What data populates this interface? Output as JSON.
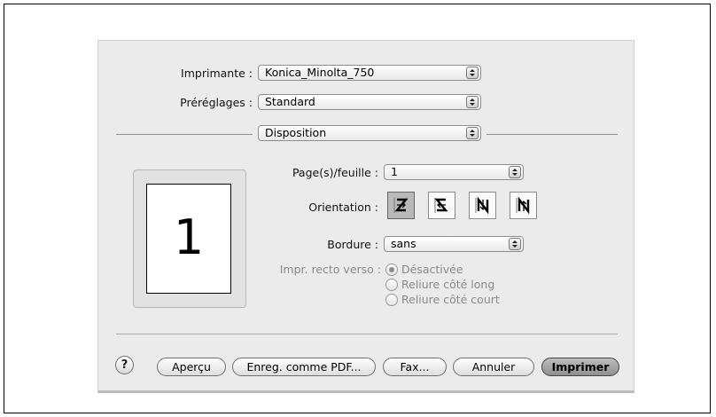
{
  "printer": {
    "label": "Imprimante :",
    "value": "Konica_Minolta_750"
  },
  "presets": {
    "label": "Préréglages :",
    "value": "Standard"
  },
  "panel": {
    "value": "Disposition"
  },
  "preview": {
    "page_number": "1"
  },
  "layout": {
    "pages_label": "Page(s)/feuille :",
    "pages_value": "1",
    "orientation_label": "Orientation :",
    "orientation_icons": [
      "z-orientation-icon",
      "reverse-z-orientation-icon",
      "n-orientation-icon",
      "reverse-n-orientation-icon"
    ],
    "border_label": "Bordure :",
    "border_value": "sans",
    "duplex_label": "Impr. recto verso :",
    "duplex_options": [
      "Désactivée",
      "Reliure côté long",
      "Reliure côté court"
    ],
    "duplex_selected": "Désactivée"
  },
  "buttons": {
    "help": "?",
    "preview": "Aperçu",
    "save_pdf": "Enreg. comme PDF...",
    "fax": "Fax...",
    "cancel": "Annuler",
    "print": "Imprimer"
  }
}
